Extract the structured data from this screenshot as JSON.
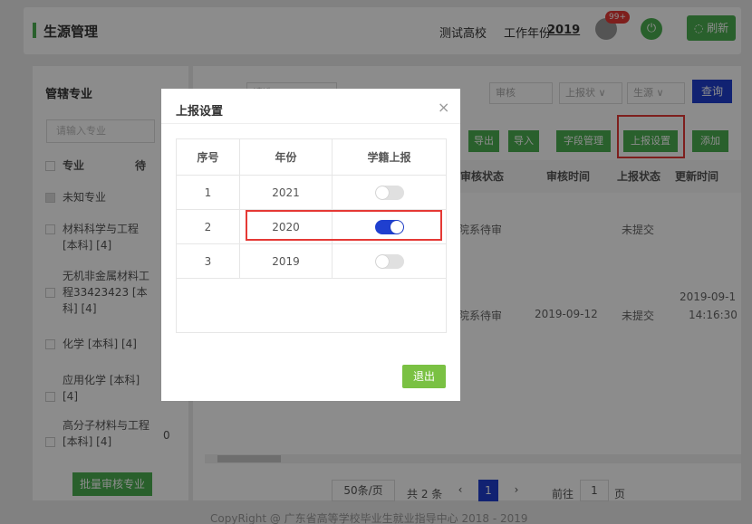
{
  "header": {
    "title": "生源管理",
    "school": "测试高校",
    "work_year_label": "工作年份",
    "work_year": "2019",
    "notification_count": "99+",
    "refresh_label": "◌ 刷新"
  },
  "left_panel": {
    "title": "管辖专业",
    "search_placeholder": "请输入专业",
    "col_major": "专业",
    "col_pending": "待",
    "items": [
      "未知专业",
      "材料科学与工程",
      "[本科] [4]",
      "无机非金属材料工",
      "程33423423 [本",
      "科] [4]",
      "化学 [本科] [4]",
      "应用化学 [本科]",
      "[4]",
      "高分子材料与工程",
      "[本科] [4]",
      "0"
    ],
    "batch_button": "批量审核专业"
  },
  "toolbar": {
    "filters": [
      "请选...",
      "审核",
      "上报状 ∨",
      "生源 ∨"
    ],
    "query_button": "查询",
    "export_button": "导出",
    "import_button": "导入",
    "field_button": "字段管理",
    "report_settings_button": "上报设置",
    "add_button": "添加"
  },
  "table": {
    "headers": [
      "审核状态",
      "审核时间",
      "上报状态",
      "更新时间"
    ],
    "rows": [
      {
        "status": "院系待审",
        "time": "",
        "report": "未提交",
        "updated": ""
      },
      {
        "status": "院系待审",
        "time": "2019-09-12",
        "report": "未提交",
        "updated_date": "2019-09-1",
        "updated_time": "14:16:30"
      }
    ]
  },
  "pagination": {
    "per_page": "50条/页",
    "total": "共 2 条",
    "current_page": "1",
    "goto_label": "前往",
    "goto_value": "1",
    "page_suffix": "页"
  },
  "copyright": "CopyRight @ 广东省高等学校毕业生就业指导中心 2018 - 2019",
  "modal": {
    "title": "上报设置",
    "close": "×",
    "headers": [
      "序号",
      "年份",
      "学籍上报"
    ],
    "rows": [
      {
        "index": "1",
        "year": "2021",
        "enabled": false
      },
      {
        "index": "2",
        "year": "2020",
        "enabled": true
      },
      {
        "index": "3",
        "year": "2019",
        "enabled": false
      }
    ],
    "exit_button": "退出"
  },
  "colors": {
    "accent_green": "#4caf50",
    "primary_blue": "#1f3fcf",
    "highlight_red": "#e53935"
  }
}
